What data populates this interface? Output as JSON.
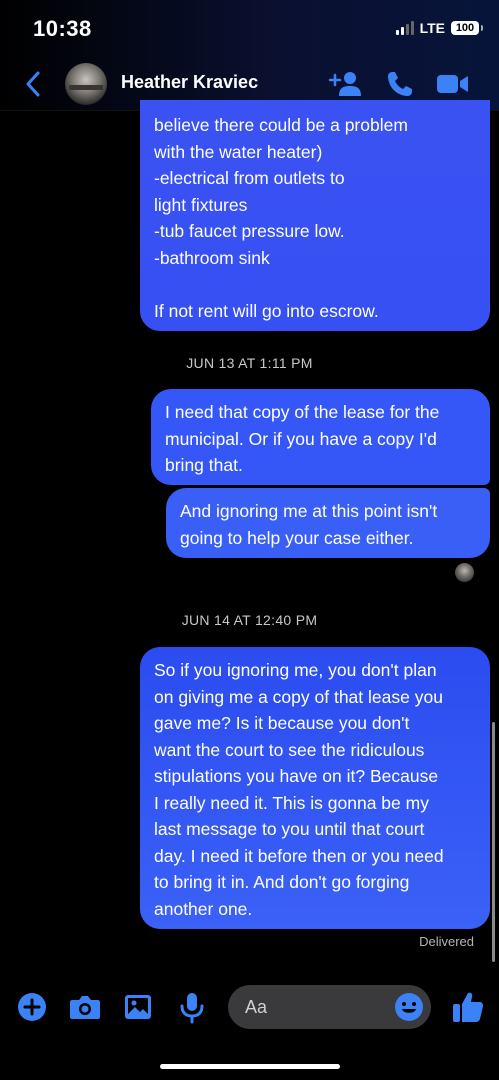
{
  "status_bar": {
    "time": "10:38",
    "network": "LTE",
    "battery": "100"
  },
  "header": {
    "contact_name": "Heather Kraviec",
    "icons": [
      "back-icon",
      "add-person-icon",
      "phone-icon",
      "video-icon"
    ]
  },
  "messages": [
    {
      "text": "believe there could be a problem\nwith the water heater)\n-electrical from outlets to\nlight fixtures\n-tub faucet pressure low.\n-bathroom sink\n\nIf not rent will go into escrow."
    },
    {
      "text": "I need that copy of the lease for the\nmunicipal. Or if you have a copy I'd\nbring that."
    },
    {
      "text": "And ignoring me at this point isn't\ngoing to help your case either."
    },
    {
      "text": "So if you ignoring me, you don't plan\non giving me a copy of that lease you\ngave me? Is it because you don't\nwant the court to see the ridiculous\nstipulations you have on it? Because\nI really need it. This is gonna be my\nlast message to you until that court\nday. I need it before then or you need\nto bring it in. And don't go forging\nanother one."
    }
  ],
  "timestamps": [
    "JUN 13 AT 1:11 PM",
    "JUN 14 AT 12:40 PM"
  ],
  "delivered_label": "Delivered",
  "composer": {
    "placeholder": "Aa",
    "icons": [
      "plus-icon",
      "camera-icon",
      "gallery-icon",
      "mic-icon",
      "emoji-icon",
      "like-icon"
    ]
  },
  "colors": {
    "accent": "#2f6cf5",
    "bubble": "#3657f7",
    "background": "#000000",
    "input": "#3a3a3c"
  }
}
